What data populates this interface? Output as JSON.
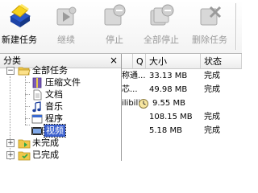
{
  "toolbar": {
    "buttons": [
      {
        "label": "新建任务",
        "enabled": true
      },
      {
        "label": "继续",
        "enabled": false
      },
      {
        "label": "停止",
        "enabled": false
      },
      {
        "label": "全部停止",
        "enabled": false
      },
      {
        "label": "删除任务",
        "enabled": false
      }
    ]
  },
  "category": {
    "header": "分类",
    "close": "×",
    "items": [
      {
        "label": "全部任务",
        "icon": "folder-icon"
      },
      {
        "label": "压缩文件",
        "icon": "archive-icon"
      },
      {
        "label": "文档",
        "icon": "document-icon"
      },
      {
        "label": "音乐",
        "icon": "music-icon"
      },
      {
        "label": "程序",
        "icon": "program-icon"
      },
      {
        "label": "视频",
        "icon": "video-icon"
      },
      {
        "label": "未完成",
        "icon": "folder-icon"
      },
      {
        "label": "已完成",
        "icon": "folder-icon"
      }
    ]
  },
  "list": {
    "columns": {
      "q": "Q",
      "size": "大小",
      "status": "状态"
    },
    "rows": [
      {
        "name": "称通...",
        "q": "",
        "size": "33.13 MB",
        "status": "完成"
      },
      {
        "name": "芯...",
        "q": "",
        "size": "49.98 MB",
        "status": "完成"
      },
      {
        "name": "ilibili...",
        "q": "",
        "size": "9.55 MB",
        "status": ""
      },
      {
        "name": "",
        "q": "",
        "size": "108.15 MB",
        "status": "完成"
      },
      {
        "name": "",
        "q": "",
        "size": "5.18 MB",
        "status": "完成"
      }
    ]
  }
}
